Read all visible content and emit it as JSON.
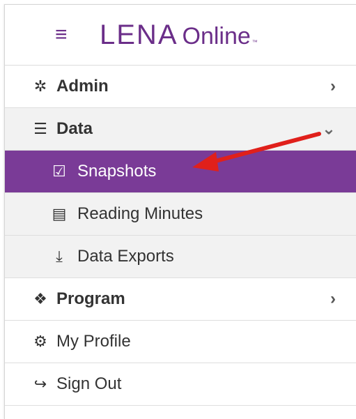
{
  "header": {
    "menu_icon": "hamburger-icon",
    "logo_lena": "LENA",
    "logo_online": "Online",
    "logo_tm": "™"
  },
  "menu": {
    "admin": {
      "label": "Admin",
      "icon": "gear-icon",
      "chevron": "chevron-right-icon"
    },
    "data": {
      "label": "Data",
      "icon": "database-icon",
      "chevron": "chevron-down-icon"
    },
    "data_items": [
      {
        "label": "Snapshots",
        "icon": "checkbox-icon",
        "active": true
      },
      {
        "label": "Reading Minutes",
        "icon": "book-icon"
      },
      {
        "label": "Data Exports",
        "icon": "download-icon"
      }
    ],
    "program": {
      "label": "Program",
      "icon": "cubes-icon",
      "chevron": "chevron-right-icon"
    },
    "profile": {
      "label": "My Profile",
      "icon": "cogs-icon"
    },
    "signout": {
      "label": "Sign Out",
      "icon": "sign-out-icon"
    }
  },
  "colors": {
    "brand_purple": "#6b2e89",
    "active_purple": "#7a3b97",
    "annotation_red": "#e0201b"
  }
}
